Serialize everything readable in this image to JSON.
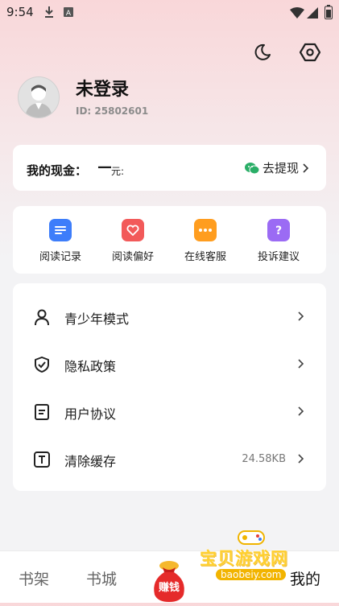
{
  "status_bar": {
    "time": "9:54"
  },
  "header": {
    "night_mode_icon": "moon-icon",
    "settings_icon": "hexagon-settings-icon"
  },
  "profile": {
    "username": "未登录",
    "id_text": "ID: 25802601"
  },
  "cash": {
    "label": "我的现金：",
    "value": "—",
    "unit": "元:",
    "withdraw_label": "去提现"
  },
  "quick_actions": [
    {
      "label": "阅读记录",
      "icon": "reading-history-icon",
      "color": "#3d7dfa"
    },
    {
      "label": "阅读偏好",
      "icon": "heart-icon",
      "color": "#f25a5a"
    },
    {
      "label": "在线客服",
      "icon": "chat-icon",
      "color": "#ff9d1f"
    },
    {
      "label": "投诉建议",
      "icon": "question-icon",
      "color": "#9b6bf4"
    }
  ],
  "menu": [
    {
      "label": "青少年模式",
      "value": "",
      "icon": "person-icon"
    },
    {
      "label": "隐私政策",
      "value": "",
      "icon": "shield-check-icon"
    },
    {
      "label": "用户协议",
      "value": "",
      "icon": "document-icon"
    },
    {
      "label": "清除缓存",
      "value": "24.58KB",
      "icon": "text-box-icon"
    }
  ],
  "bottom_nav": {
    "bookshelf": "书架",
    "bookstore": "书城",
    "earn": "赚钱",
    "mine": "我的"
  },
  "watermark": {
    "text": "宝贝游戏网",
    "url": "baobeiy.com"
  }
}
